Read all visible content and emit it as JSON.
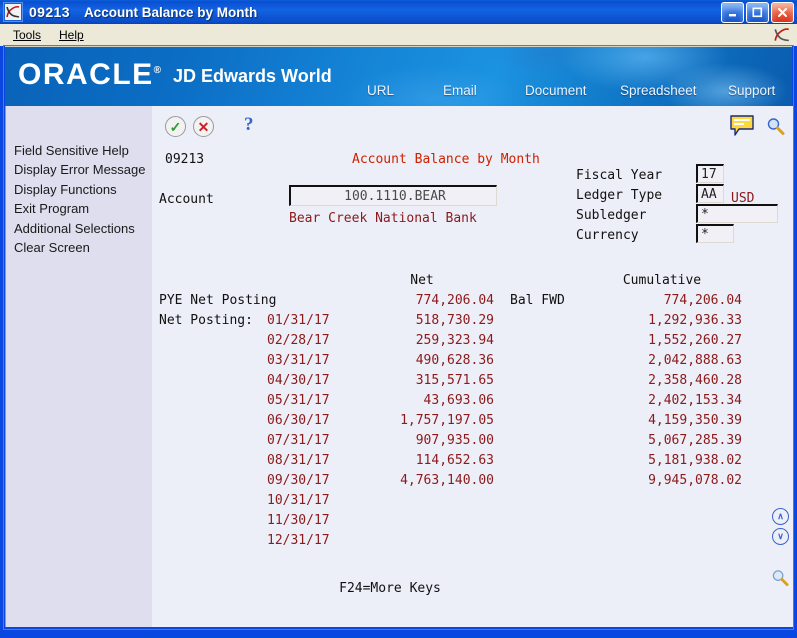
{
  "window": {
    "program_id": "09213",
    "title": "Account Balance by Month",
    "icon": "jde-window-icon",
    "buttons": {
      "minimize": "_",
      "maximize": "□",
      "close": "✕"
    }
  },
  "menubar": {
    "items": [
      "Tools",
      "Help"
    ],
    "right_icon": "jde-logo-icon"
  },
  "banner": {
    "brand": "ORACLE",
    "product": "JD Edwards World",
    "nav": [
      "URL",
      "Email",
      "Document",
      "Spreadsheet",
      "Support"
    ]
  },
  "toolbar": {
    "accept_icon": "✓",
    "cancel_icon": "✕",
    "help_icon": "?",
    "note_icon": "note-icon",
    "search_icon": "magnifier-icon"
  },
  "sidebar": {
    "items": [
      "Field Sensitive Help",
      "Display Error Message",
      "Display Functions",
      "Exit Program",
      "Additional Selections",
      "Clear Screen"
    ]
  },
  "form": {
    "program_id": "09213",
    "title": "Account Balance by Month",
    "account_label": "Account",
    "account_value": "100.1110.BEAR",
    "account_description": "Bear Creek National Bank",
    "fields": [
      {
        "label": "Fiscal Year",
        "value": "17"
      },
      {
        "label": "Ledger Type",
        "value": "AA"
      },
      {
        "label": "Subledger",
        "value": "*"
      },
      {
        "label": "Currency",
        "value": "*"
      }
    ],
    "currency_code": "USD"
  },
  "table": {
    "headers": {
      "net": "Net",
      "cumulative": "Cumulative"
    },
    "pye": {
      "label": "PYE Net Posting",
      "net": "774,206.04",
      "bal_fwd_label": "Bal FWD",
      "cumulative": "774,206.04"
    },
    "net_posting_label": "Net Posting:",
    "rows": [
      {
        "date": "01/31/17",
        "net": "518,730.29",
        "cumulative": "1,292,936.33"
      },
      {
        "date": "02/28/17",
        "net": "259,323.94",
        "cumulative": "1,552,260.27"
      },
      {
        "date": "03/31/17",
        "net": "490,628.36",
        "cumulative": "2,042,888.63"
      },
      {
        "date": "04/30/17",
        "net": "315,571.65",
        "cumulative": "2,358,460.28"
      },
      {
        "date": "05/31/17",
        "net": "43,693.06",
        "cumulative": "2,402,153.34"
      },
      {
        "date": "06/30/17",
        "net": "1,757,197.05",
        "cumulative": "4,159,350.39"
      },
      {
        "date": "07/31/17",
        "net": "907,935.00",
        "cumulative": "5,067,285.39"
      },
      {
        "date": "08/31/17",
        "net": "114,652.63",
        "cumulative": "5,181,938.02"
      },
      {
        "date": "09/30/17",
        "net": "4,763,140.00",
        "cumulative": "9,945,078.02"
      },
      {
        "date": "10/31/17",
        "net": "",
        "cumulative": ""
      },
      {
        "date": "11/30/17",
        "net": "",
        "cumulative": ""
      },
      {
        "date": "12/31/17",
        "net": "",
        "cumulative": ""
      }
    ]
  },
  "footer": {
    "function_keys": "F24=More Keys"
  },
  "side_controls": {
    "page_up_icon": "∧",
    "page_down_icon": "∨",
    "find_icon": "magnifier-icon"
  },
  "colors": {
    "title_blue": "#0a4fd2",
    "frame_blue": "#0a46e0",
    "panel_bg": "#eceef8",
    "sidebar_bg": "#dedeee",
    "field_red": "#8b1a1a",
    "title_red": "#cc2200",
    "banner_blue": "#1584d6"
  }
}
